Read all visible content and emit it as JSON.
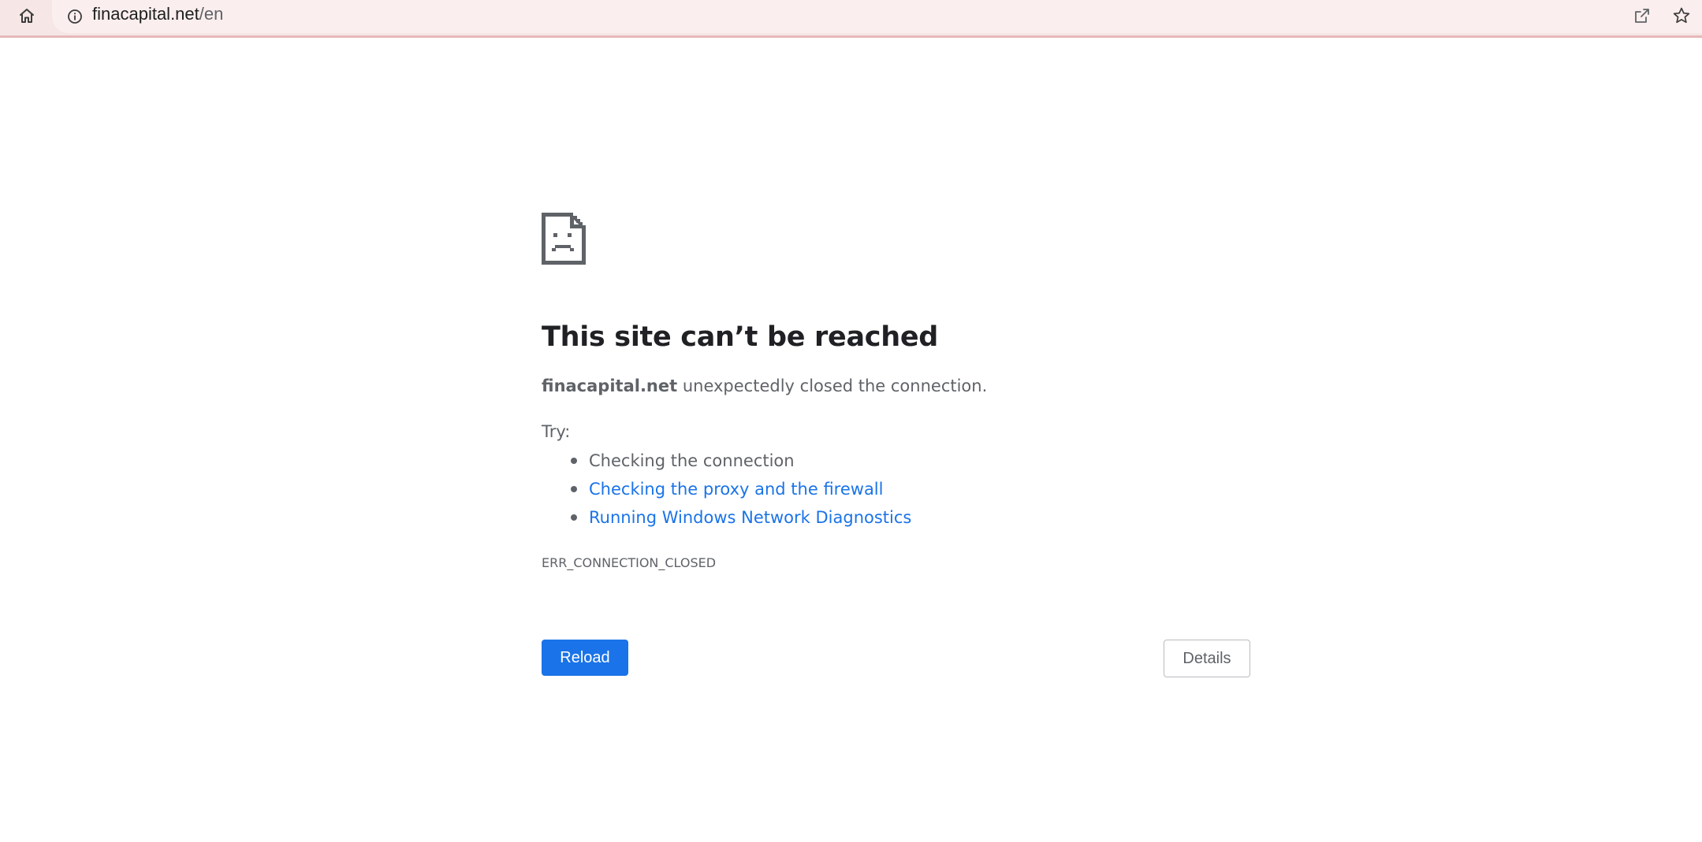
{
  "toolbar": {
    "home_icon": "home-icon",
    "address_bar": {
      "info_icon": "info-icon",
      "domain": "finacapital.net",
      "path": "/en"
    },
    "share_icon": "share-icon",
    "star_icon": "star-icon"
  },
  "error_page": {
    "icon": "sad-page-icon",
    "heading": "This site can’t be reached",
    "message_host": "finacapital.net",
    "message_text": " unexpectedly closed the connection.",
    "try_label": "Try:",
    "suggestions": [
      {
        "label": "Checking the connection",
        "is_link": false
      },
      {
        "label": "Checking the proxy and the firewall",
        "is_link": true
      },
      {
        "label": "Running Windows Network Diagnostics",
        "is_link": true
      }
    ],
    "error_code": "ERR_CONNECTION_CLOSED",
    "reload_label": "Reload",
    "details_label": "Details"
  },
  "colors": {
    "toolbar_bg": "#f6e6e6",
    "link": "#1a73e8",
    "primary_button": "#1a73e8",
    "text": "#5f6368",
    "heading": "#202124"
  }
}
